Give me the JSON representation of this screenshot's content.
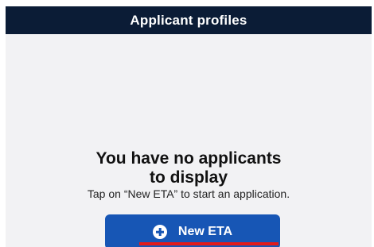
{
  "header": {
    "title": "Applicant profiles"
  },
  "empty_state": {
    "title_line1": "You have no applicants",
    "title_line2": "to display",
    "subtitle": "Tap on “New ETA” to start an application."
  },
  "button": {
    "label": "New ETA",
    "icon": "plus-circle-icon"
  },
  "colors": {
    "header_bg": "#0b1c36",
    "button_bg": "#1756b5",
    "highlight": "#e21a1a",
    "screen_bg": "#f2f2f4"
  }
}
